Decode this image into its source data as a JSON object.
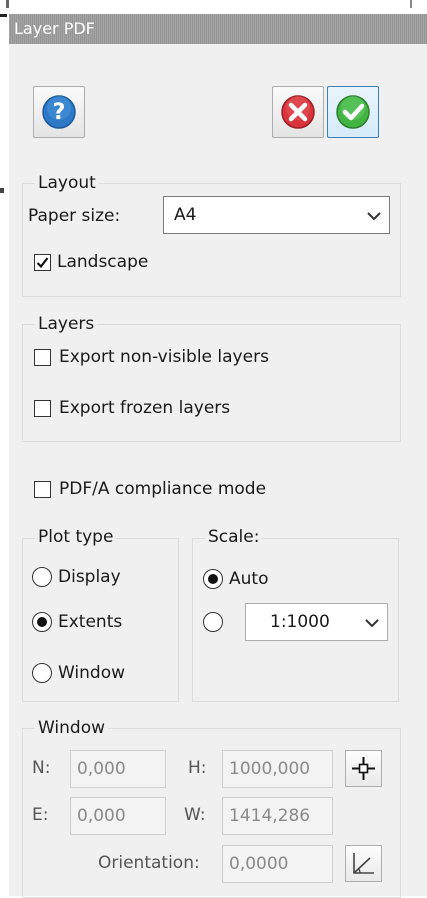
{
  "window": {
    "title": "Layer PDF"
  },
  "toolbar": {
    "help_icon": "help-icon",
    "cancel_icon": "cancel-icon",
    "ok_icon": "ok-icon"
  },
  "layout": {
    "legend": "Layout",
    "paper_size_label": "Paper size:",
    "paper_size_value": "A4",
    "landscape_label": "Landscape",
    "landscape_checked": true
  },
  "layers": {
    "legend": "Layers",
    "export_nonvisible_label": "Export non-visible layers",
    "export_nonvisible_checked": false,
    "export_frozen_label": "Export frozen layers",
    "export_frozen_checked": false
  },
  "pdfa": {
    "label": "PDF/A compliance mode",
    "checked": false
  },
  "plot_type": {
    "legend": "Plot type",
    "options": [
      "Display",
      "Extents",
      "Window"
    ],
    "selected": "Extents"
  },
  "scale": {
    "legend": "Scale:",
    "auto_label": "Auto",
    "selected": "Auto",
    "custom_value": "1:1000"
  },
  "window_group": {
    "legend": "Window",
    "n_label": "N:",
    "n_value": "0,000",
    "h_label": "H:",
    "h_value": "1000,000",
    "e_label": "E:",
    "e_value": "0,000",
    "w_label": "W:",
    "w_value": "1414,286",
    "orientation_label": "Orientation:",
    "orientation_value": "0,0000",
    "pick_point_icon": "crosshair-icon",
    "pick_angle_icon": "angle-icon"
  },
  "colors": {
    "accent_ok": "#3c7fb1",
    "titlebar": "#9a9a9a",
    "disabled_text": "#8a8a8a"
  }
}
